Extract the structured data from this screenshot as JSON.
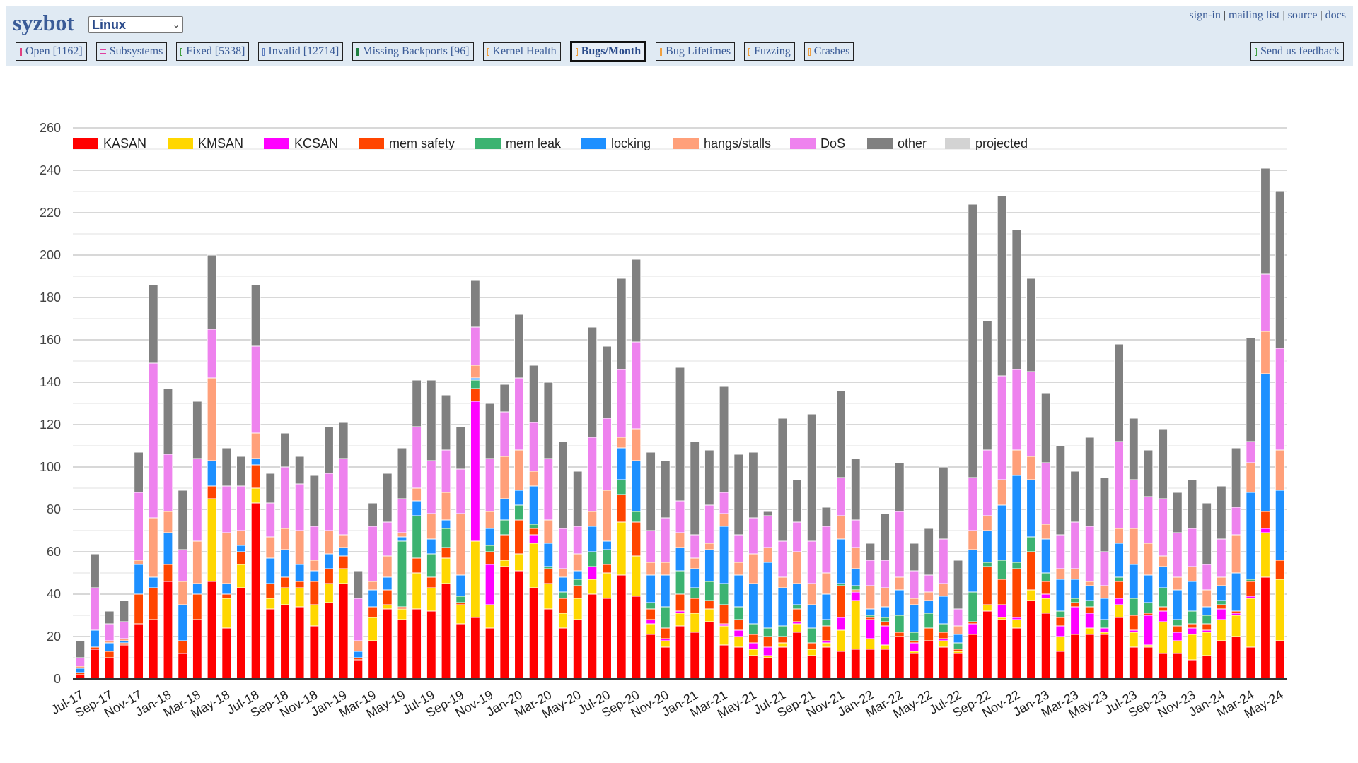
{
  "header": {
    "logo": "syzbot",
    "namespace_selected": "Linux",
    "links": [
      "sign-in",
      "mailing list",
      "source",
      "docs"
    ],
    "tabs": [
      {
        "label": "Open [1162]",
        "icon": "bug-icon",
        "color": "#e04080",
        "active": false
      },
      {
        "label": "Subsystems",
        "icon": "list-icon",
        "color": "#e040a0",
        "active": false
      },
      {
        "label": "Fixed [5338]",
        "icon": "check-icon",
        "color": "#40a040",
        "active": false
      },
      {
        "label": "Invalid [12714]",
        "icon": "cross-icon",
        "color": "#6080c0",
        "active": false
      },
      {
        "label": "Missing Backports [96]",
        "icon": "arrow-down-icon",
        "color": "#208040",
        "active": false
      },
      {
        "label": "Kernel Health",
        "icon": "health-icon",
        "color": "#f0a040",
        "active": false
      },
      {
        "label": "Bugs/Month",
        "icon": "chart-icon",
        "color": "#f0a040",
        "active": true
      },
      {
        "label": "Bug Lifetimes",
        "icon": "chart-icon",
        "color": "#f0a040",
        "active": false
      },
      {
        "label": "Fuzzing",
        "icon": "chart-icon",
        "color": "#f0a040",
        "active": false
      },
      {
        "label": "Crashes",
        "icon": "chart-icon",
        "color": "#f0a040",
        "active": false
      }
    ],
    "feedback": {
      "label": "Send us feedback",
      "icon": "mail-icon",
      "color": "#40a040"
    }
  },
  "chart_data": {
    "type": "bar",
    "stacked": true,
    "title": "",
    "xlabel": "",
    "ylabel": "",
    "ylim": [
      0,
      260
    ],
    "yticks": [
      0,
      20,
      40,
      60,
      80,
      100,
      120,
      140,
      160,
      180,
      200,
      220,
      240,
      260
    ],
    "grid": true,
    "legend_position": "top",
    "legend": [
      {
        "name": "KASAN",
        "color": "#ff0000"
      },
      {
        "name": "KMSAN",
        "color": "#ffd700"
      },
      {
        "name": "KCSAN",
        "color": "#ff00ff"
      },
      {
        "name": "mem safety",
        "color": "#ff4500"
      },
      {
        "name": "mem leak",
        "color": "#3cb371"
      },
      {
        "name": "locking",
        "color": "#1e90ff"
      },
      {
        "name": "hangs/stalls",
        "color": "#ffa07a"
      },
      {
        "name": "DoS",
        "color": "#ee82ee"
      },
      {
        "name": "other",
        "color": "#808080"
      },
      {
        "name": "projected",
        "color": "#d3d3d3"
      }
    ],
    "categories": [
      "Jul-17",
      "Aug-17",
      "Sep-17",
      "Oct-17",
      "Nov-17",
      "Dec-17",
      "Jan-18",
      "Feb-18",
      "Mar-18",
      "Apr-18",
      "May-18",
      "Jun-18",
      "Jul-18",
      "Aug-18",
      "Sep-18",
      "Oct-18",
      "Nov-18",
      "Dec-18",
      "Jan-19",
      "Feb-19",
      "Mar-19",
      "Apr-19",
      "May-19",
      "Jun-19",
      "Jul-19",
      "Aug-19",
      "Sep-19",
      "Oct-19",
      "Nov-19",
      "Dec-19",
      "Jan-20",
      "Feb-20",
      "Mar-20",
      "Apr-20",
      "May-20",
      "Jun-20",
      "Jul-20",
      "Aug-20",
      "Sep-20",
      "Oct-20",
      "Nov-20",
      "Dec-20",
      "Jan-21",
      "Feb-21",
      "Mar-21",
      "Apr-21",
      "May-21",
      "Jun-21",
      "Jul-21",
      "Aug-21",
      "Sep-21",
      "Oct-21",
      "Nov-21",
      "Dec-21",
      "Jan-22",
      "Feb-22",
      "Mar-22",
      "Apr-22",
      "May-22",
      "Jun-22",
      "Jul-22",
      "Aug-22",
      "Sep-22",
      "Oct-22",
      "Nov-22",
      "Dec-22",
      "Jan-23",
      "Feb-23",
      "Mar-23",
      "Apr-23",
      "May-23",
      "Jun-23",
      "Jul-23",
      "Aug-23",
      "Sep-23",
      "Oct-23",
      "Nov-23",
      "Dec-23",
      "Jan-24",
      "Feb-24",
      "Mar-24",
      "Apr-24",
      "May-24"
    ],
    "xtick_labels": [
      "Jul-17",
      "Sep-17",
      "Nov-17",
      "Jan-18",
      "Mar-18",
      "May-18",
      "Jul-18",
      "Sep-18",
      "Nov-18",
      "Jan-19",
      "Mar-19",
      "May-19",
      "Jul-19",
      "Sep-19",
      "Nov-19",
      "Jan-20",
      "Mar-20",
      "May-20",
      "Jul-20",
      "Sep-20",
      "Nov-20",
      "Jan-21",
      "Mar-21",
      "May-21",
      "Jul-21",
      "Sep-21",
      "Nov-21",
      "Jan-22",
      "Mar-22",
      "May-22",
      "Jul-22",
      "Sep-22",
      "Nov-22",
      "Jan-23",
      "Mar-23",
      "May-23",
      "Jul-23",
      "Sep-23",
      "Nov-23",
      "Jan-24",
      "Mar-24",
      "May-24"
    ],
    "series": [
      {
        "name": "KASAN",
        "values": [
          2,
          14,
          10,
          16,
          26,
          28,
          46,
          12,
          28,
          46,
          24,
          43,
          83,
          33,
          35,
          34,
          25,
          36,
          45,
          9,
          18,
          33,
          28,
          33,
          32,
          45,
          26,
          29,
          24,
          53,
          51,
          43,
          33,
          24,
          28,
          40,
          38,
          49,
          39,
          21,
          15,
          25,
          22,
          27,
          16,
          15,
          11,
          10,
          15,
          22,
          11,
          15,
          13,
          14,
          14,
          14,
          20,
          12,
          18,
          15,
          12,
          21,
          32,
          28,
          24,
          37,
          31,
          13,
          21,
          21,
          21,
          29,
          15,
          15,
          12,
          12,
          9,
          11,
          18,
          20,
          15,
          48,
          18
        ]
      },
      {
        "name": "KMSAN",
        "values": [
          0,
          0,
          0,
          0,
          0,
          0,
          0,
          0,
          0,
          39,
          14,
          11,
          7,
          5,
          8,
          9,
          10,
          9,
          7,
          0,
          11,
          2,
          5,
          17,
          11,
          12,
          9,
          36,
          11,
          3,
          8,
          21,
          12,
          7,
          10,
          7,
          12,
          25,
          19,
          5,
          3,
          6,
          9,
          6,
          9,
          5,
          3,
          1,
          2,
          4,
          3,
          2,
          10,
          23,
          5,
          2,
          0,
          1,
          0,
          3,
          1,
          0,
          3,
          1,
          4,
          5,
          7,
          7,
          0,
          3,
          1,
          6,
          7,
          1,
          15,
          6,
          12,
          11,
          10,
          10,
          23,
          21,
          29
        ]
      },
      {
        "name": "KCSAN",
        "values": [
          0,
          0,
          0,
          0,
          0,
          0,
          0,
          0,
          0,
          0,
          0,
          0,
          0,
          0,
          0,
          0,
          0,
          0,
          0,
          0,
          0,
          0,
          0,
          0,
          0,
          0,
          0,
          66,
          19,
          0,
          0,
          4,
          0,
          0,
          0,
          6,
          0,
          0,
          0,
          2,
          1,
          1,
          0,
          0,
          1,
          3,
          3,
          4,
          0,
          1,
          0,
          1,
          6,
          4,
          9,
          9,
          0,
          4,
          0,
          1,
          0,
          5,
          0,
          6,
          1,
          0,
          2,
          5,
          13,
          7,
          2,
          3,
          1,
          14,
          5,
          4,
          3,
          1,
          5,
          1,
          1,
          2,
          0
        ]
      },
      {
        "name": "mem safety",
        "values": [
          1,
          1,
          3,
          1,
          14,
          15,
          8,
          6,
          12,
          6,
          2,
          6,
          11,
          7,
          5,
          3,
          11,
          7,
          6,
          1,
          5,
          7,
          1,
          7,
          5,
          5,
          1,
          6,
          6,
          12,
          16,
          3,
          7,
          7,
          6,
          0,
          4,
          13,
          16,
          5,
          5,
          8,
          7,
          4,
          9,
          5,
          4,
          5,
          3,
          6,
          3,
          7,
          15,
          1,
          1,
          2,
          2,
          1,
          6,
          3,
          1,
          1,
          18,
          12,
          23,
          18,
          6,
          4,
          2,
          3,
          0,
          8,
          7,
          1,
          2,
          3,
          2,
          3,
          2,
          1,
          7,
          8,
          9
        ]
      },
      {
        "name": "mem leak",
        "values": [
          0,
          0,
          0,
          0,
          0,
          0,
          0,
          0,
          0,
          0,
          0,
          0,
          0,
          0,
          0,
          0,
          0,
          0,
          0,
          0,
          0,
          0,
          31,
          20,
          11,
          9,
          3,
          4,
          3,
          7,
          7,
          2,
          1,
          3,
          3,
          7,
          7,
          7,
          5,
          3,
          10,
          11,
          5,
          9,
          10,
          6,
          5,
          4,
          5,
          2,
          7,
          3,
          1,
          2,
          1,
          2,
          8,
          4,
          7,
          4,
          3,
          14,
          2,
          9,
          3,
          7,
          4,
          3,
          2,
          3,
          4,
          2,
          8,
          5,
          9,
          3,
          6,
          4,
          2,
          0,
          1,
          0,
          0
        ]
      },
      {
        "name": "locking",
        "values": [
          2,
          8,
          4,
          1,
          14,
          5,
          15,
          17,
          5,
          12,
          5,
          3,
          3,
          12,
          13,
          8,
          5,
          7,
          4,
          3,
          8,
          6,
          2,
          7,
          7,
          4,
          10,
          1,
          8,
          10,
          7,
          18,
          11,
          7,
          4,
          12,
          4,
          15,
          24,
          13,
          15,
          11,
          9,
          15,
          27,
          15,
          19,
          31,
          18,
          10,
          11,
          12,
          21,
          8,
          3,
          5,
          12,
          13,
          6,
          13,
          4,
          20,
          15,
          26,
          41,
          27,
          16,
          15,
          9,
          7,
          10,
          16,
          16,
          13,
          10,
          14,
          14,
          4,
          7,
          18,
          41,
          65,
          33
        ]
      },
      {
        "name": "hangs/stalls",
        "values": [
          1,
          0,
          1,
          1,
          2,
          28,
          10,
          11,
          20,
          39,
          24,
          7,
          12,
          10,
          10,
          16,
          5,
          11,
          6,
          5,
          4,
          10,
          2,
          6,
          12,
          13,
          29,
          6,
          8,
          20,
          19,
          7,
          11,
          4,
          8,
          7,
          24,
          5,
          15,
          6,
          6,
          7,
          5,
          3,
          6,
          6,
          14,
          7,
          5,
          15,
          10,
          10,
          11,
          10,
          11,
          9,
          6,
          3,
          4,
          6,
          4,
          9,
          7,
          12,
          12,
          11,
          7,
          5,
          5,
          2,
          6,
          7,
          17,
          15,
          5,
          6,
          7,
          8,
          4,
          18,
          14,
          20,
          19
        ]
      },
      {
        "name": "DoS",
        "values": [
          4,
          20,
          8,
          8,
          32,
          73,
          27,
          15,
          39,
          23,
          22,
          21,
          41,
          16,
          29,
          22,
          16,
          27,
          36,
          20,
          26,
          16,
          16,
          29,
          25,
          20,
          21,
          18,
          25,
          21,
          34,
          23,
          29,
          19,
          13,
          35,
          34,
          32,
          41,
          15,
          21,
          15,
          11,
          18,
          10,
          13,
          17,
          15,
          17,
          14,
          20,
          22,
          18,
          13,
          12,
          13,
          31,
          13,
          8,
          21,
          8,
          25,
          31,
          49,
          38,
          40,
          29,
          16,
          22,
          26,
          16,
          41,
          23,
          22,
          27,
          21,
          18,
          12,
          18,
          13,
          10,
          27,
          48
        ]
      },
      {
        "name": "other",
        "values": [
          8,
          16,
          6,
          10,
          19,
          37,
          31,
          28,
          27,
          35,
          18,
          14,
          29,
          14,
          16,
          13,
          24,
          22,
          17,
          13,
          11,
          23,
          24,
          22,
          38,
          26,
          20,
          22,
          26,
          13,
          30,
          27,
          36,
          41,
          26,
          52,
          34,
          43,
          39,
          37,
          27,
          63,
          44,
          26,
          50,
          38,
          31,
          2,
          58,
          20,
          60,
          9,
          41,
          29,
          8,
          22,
          23,
          13,
          22,
          34,
          23,
          129,
          61,
          85,
          66,
          44,
          33,
          42,
          24,
          42,
          35,
          46,
          29,
          22,
          33,
          19,
          23,
          29,
          25,
          28,
          49,
          50,
          74
        ]
      }
    ]
  }
}
